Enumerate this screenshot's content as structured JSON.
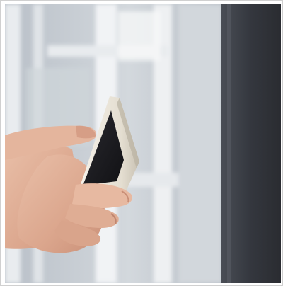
{
  "photo": {
    "subject_icons": [
      "hand-icon",
      "smartphone-icon"
    ],
    "colors": {
      "background_glass": "#c7cdd3",
      "window_frame": "#eef0f2",
      "dark_panel": "#3a3d44",
      "skin": "#e2b29a",
      "skin_shadow": "#c98f77",
      "phone_body": "#ece7dc",
      "phone_screen": "#1c1c20"
    }
  }
}
